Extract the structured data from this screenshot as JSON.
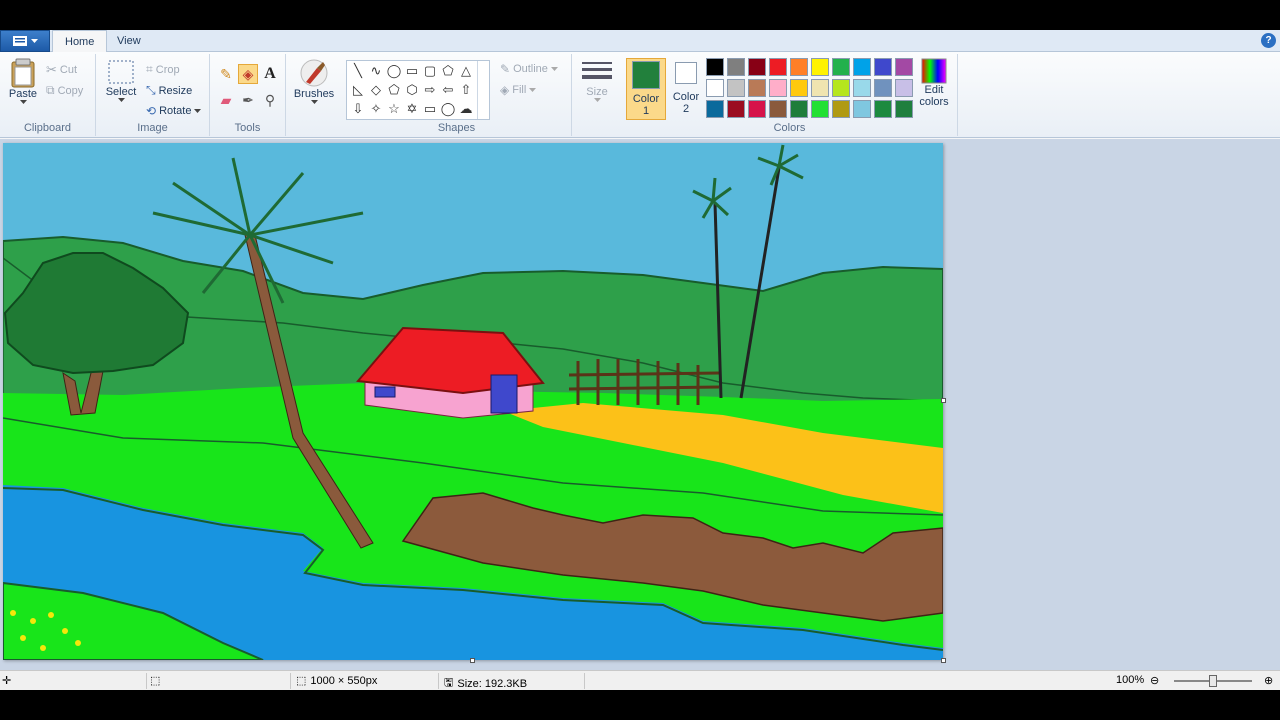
{
  "tabs": {
    "home": "Home",
    "view": "View"
  },
  "help_icon": "help-icon",
  "clipboard": {
    "paste": "Paste",
    "cut": "Cut",
    "copy": "Copy",
    "label": "Clipboard"
  },
  "image": {
    "select": "Select",
    "crop": "Crop",
    "resize": "Resize",
    "rotate": "Rotate",
    "label": "Image"
  },
  "tools": {
    "label": "Tools",
    "text_tool": "A"
  },
  "brushes": {
    "label": "Brushes"
  },
  "shapes": {
    "outline": "Outline",
    "fill": "Fill",
    "label": "Shapes"
  },
  "size": {
    "label": "Size"
  },
  "colors": {
    "color1_label": "Color",
    "color1_num": "1",
    "color2_label": "Color",
    "color2_num": "2",
    "color1_value": "#22803c",
    "color2_value": "#ffffff",
    "edit_label": "Edit",
    "edit_label2": "colors",
    "label": "Colors",
    "palette_row1": [
      "#000000",
      "#7f7f7f",
      "#880015",
      "#ed1c24",
      "#ff7f27",
      "#fff200",
      "#22b14c",
      "#00a2e8",
      "#3f48cc",
      "#a349a4"
    ],
    "palette_row2": [
      "#ffffff",
      "#c3c3c3",
      "#b97a57",
      "#ffaec9",
      "#ffc90e",
      "#efe4b0",
      "#b5e61d",
      "#99d9ea",
      "#7092be",
      "#c8bfe7"
    ],
    "palette_row3": [
      "#0b6a9c",
      "#9b0d21",
      "#d6134a",
      "#8a5a3c",
      "#1e7d3a",
      "#22e033",
      "#b09a12",
      "#7fc7e0",
      "#1d8a3f",
      "#1f7f3e"
    ]
  },
  "status": {
    "dimensions": "1000 × 550px",
    "size": "Size: 192.3KB",
    "zoom": "100%",
    "zoom_level": 0.5
  }
}
